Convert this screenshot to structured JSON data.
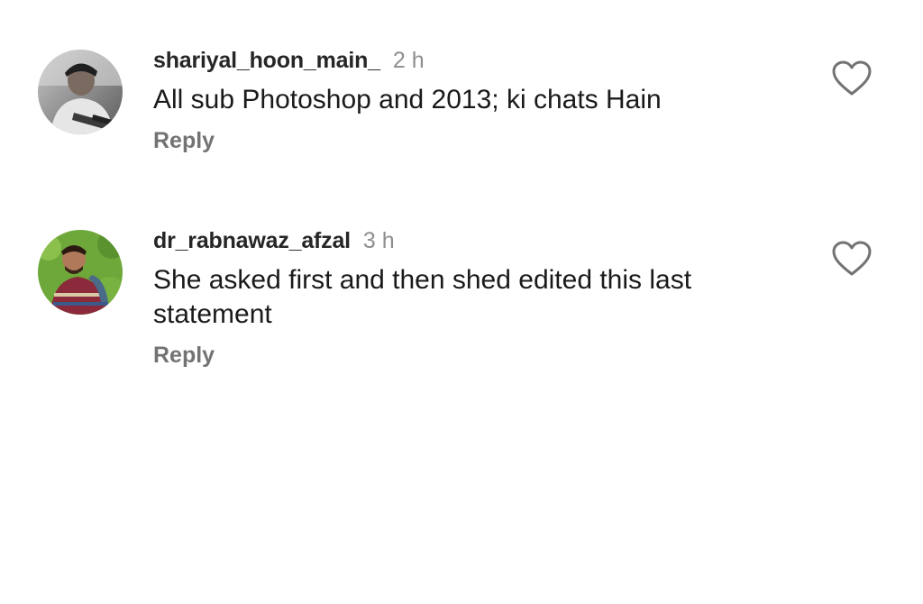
{
  "comments": [
    {
      "username": "shariyal_hoon_main_",
      "time": "2 h",
      "text": "All sub Photoshop and 2013; ki chats Hain",
      "reply_label": "Reply",
      "avatar_icon": "user-avatar",
      "like_icon": "heart-outline-icon"
    },
    {
      "username": "dr_rabnawaz_afzal",
      "time": "3 h",
      "text": "She asked first and then shed edited this last statement",
      "reply_label": "Reply",
      "avatar_icon": "user-avatar",
      "like_icon": "heart-outline-icon"
    }
  ]
}
